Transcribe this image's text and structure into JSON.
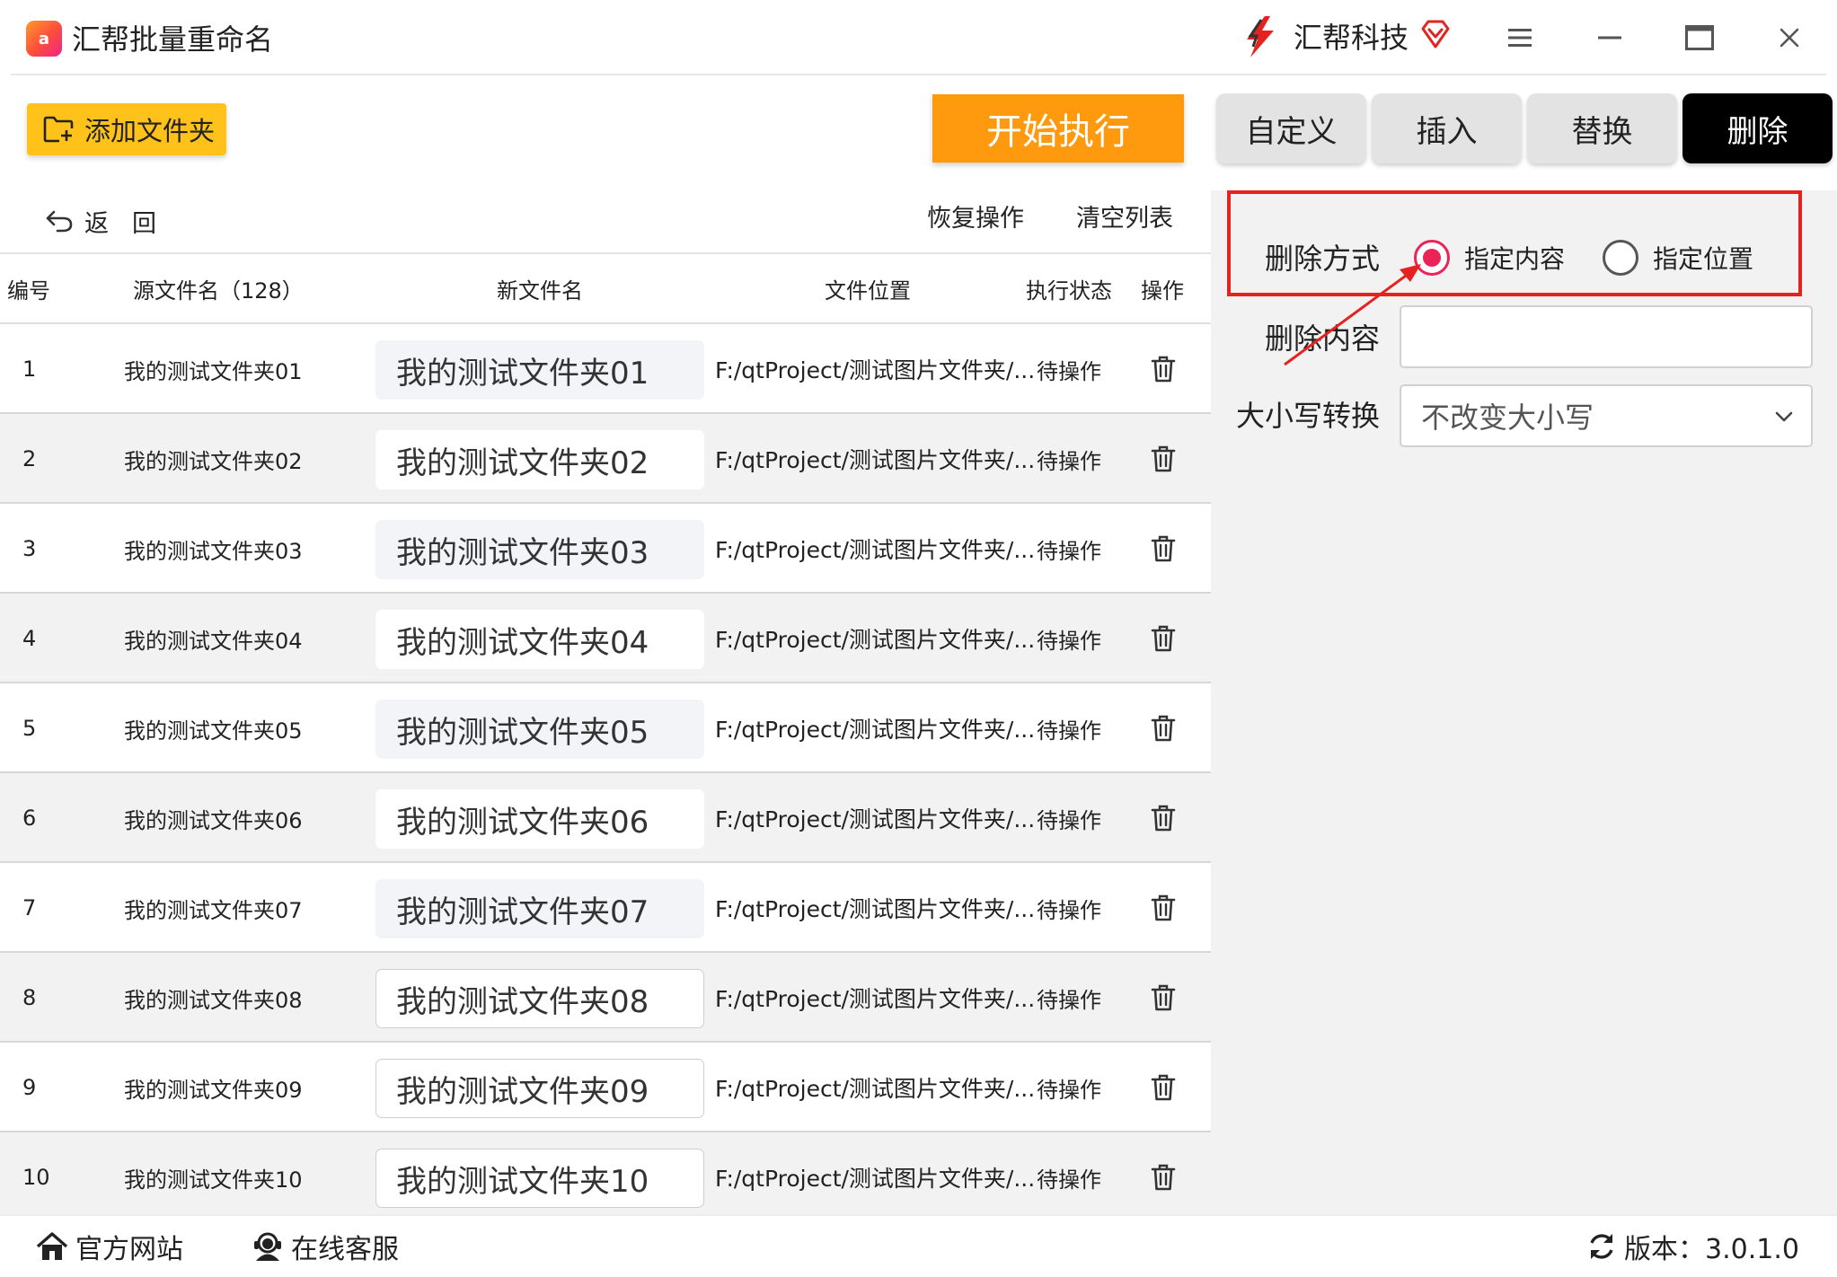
{
  "window": {
    "title": "汇帮批量重命名",
    "app_logo_text": "a",
    "brand_name": "汇帮科技",
    "icons": [
      "menu-icon",
      "minimize-icon",
      "maximize-icon",
      "close-icon"
    ]
  },
  "toolbar": {
    "add_folder_label": "添加文件夹",
    "start_label": "开始执行",
    "tabs": [
      {
        "label": "自定义",
        "active": false
      },
      {
        "label": "插入",
        "active": false
      },
      {
        "label": "替换",
        "active": false
      },
      {
        "label": "删除",
        "active": true
      }
    ]
  },
  "list_controls": {
    "back_label": "返回",
    "restore_label": "恢复操作",
    "clear_label": "清空列表"
  },
  "table": {
    "headers": {
      "num": "编号",
      "source": "源文件名（128）",
      "new_name": "新文件名",
      "location": "文件位置",
      "status": "执行状态",
      "action": "操作"
    },
    "rows": [
      {
        "num": "1",
        "source": "我的测试文件夹01",
        "new_name": "我的测试文件夹01",
        "location": "F:/qtProject/测试图片文件夹/...",
        "status": "待操作"
      },
      {
        "num": "2",
        "source": "我的测试文件夹02",
        "new_name": "我的测试文件夹02",
        "location": "F:/qtProject/测试图片文件夹/...",
        "status": "待操作"
      },
      {
        "num": "3",
        "source": "我的测试文件夹03",
        "new_name": "我的测试文件夹03",
        "location": "F:/qtProject/测试图片文件夹/...",
        "status": "待操作"
      },
      {
        "num": "4",
        "source": "我的测试文件夹04",
        "new_name": "我的测试文件夹04",
        "location": "F:/qtProject/测试图片文件夹/...",
        "status": "待操作"
      },
      {
        "num": "5",
        "source": "我的测试文件夹05",
        "new_name": "我的测试文件夹05",
        "location": "F:/qtProject/测试图片文件夹/...",
        "status": "待操作"
      },
      {
        "num": "6",
        "source": "我的测试文件夹06",
        "new_name": "我的测试文件夹06",
        "location": "F:/qtProject/测试图片文件夹/...",
        "status": "待操作"
      },
      {
        "num": "7",
        "source": "我的测试文件夹07",
        "new_name": "我的测试文件夹07",
        "location": "F:/qtProject/测试图片文件夹/...",
        "status": "待操作"
      },
      {
        "num": "8",
        "source": "我的测试文件夹08",
        "new_name": "我的测试文件夹08",
        "location": "F:/qtProject/测试图片文件夹/...",
        "status": "待操作"
      },
      {
        "num": "9",
        "source": "我的测试文件夹09",
        "new_name": "我的测试文件夹09",
        "location": "F:/qtProject/测试图片文件夹/...",
        "status": "待操作"
      },
      {
        "num": "10",
        "source": "我的测试文件夹10",
        "new_name": "我的测试文件夹10",
        "location": "F:/qtProject/测试图片文件夹/...",
        "status": "待操作"
      }
    ]
  },
  "panel": {
    "delete_mode_label": "删除方式",
    "option_content": "指定内容",
    "option_position": "指定位置",
    "selected_option": "指定内容",
    "delete_content_label": "删除内容",
    "delete_content_value": "",
    "case_label": "大小写转换",
    "case_value": "不改变大小写"
  },
  "footer": {
    "website_label": "官方网站",
    "support_label": "在线客服",
    "version_label": "版本：3.0.1.0"
  },
  "colors": {
    "accent_orange": "#ff9a0f",
    "add_button_yellow": "#ffc21a",
    "active_tab": "#000000",
    "radio_selected": "#ec2356",
    "annotation_red": "#e5221f"
  }
}
